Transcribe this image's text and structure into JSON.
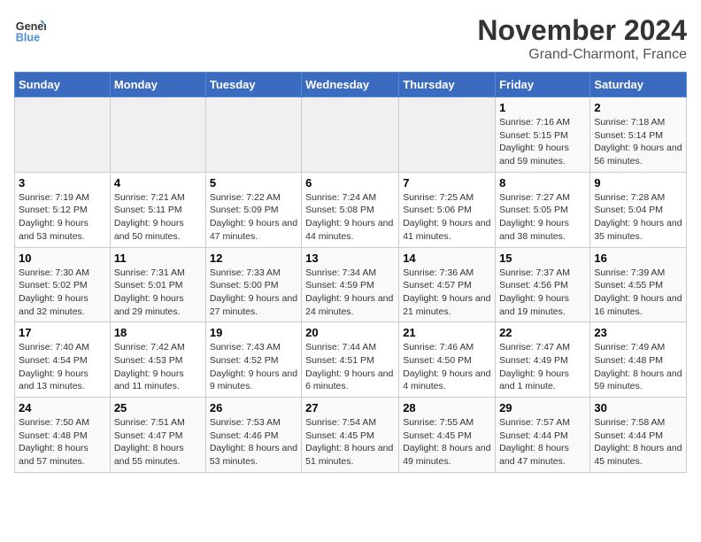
{
  "header": {
    "logo_line1": "General",
    "logo_line2": "Blue",
    "month_title": "November 2024",
    "location": "Grand-Charmont, France"
  },
  "weekdays": [
    "Sunday",
    "Monday",
    "Tuesday",
    "Wednesday",
    "Thursday",
    "Friday",
    "Saturday"
  ],
  "weeks": [
    [
      {
        "day": "",
        "info": ""
      },
      {
        "day": "",
        "info": ""
      },
      {
        "day": "",
        "info": ""
      },
      {
        "day": "",
        "info": ""
      },
      {
        "day": "",
        "info": ""
      },
      {
        "day": "1",
        "info": "Sunrise: 7:16 AM\nSunset: 5:15 PM\nDaylight: 9 hours and 59 minutes."
      },
      {
        "day": "2",
        "info": "Sunrise: 7:18 AM\nSunset: 5:14 PM\nDaylight: 9 hours and 56 minutes."
      }
    ],
    [
      {
        "day": "3",
        "info": "Sunrise: 7:19 AM\nSunset: 5:12 PM\nDaylight: 9 hours and 53 minutes."
      },
      {
        "day": "4",
        "info": "Sunrise: 7:21 AM\nSunset: 5:11 PM\nDaylight: 9 hours and 50 minutes."
      },
      {
        "day": "5",
        "info": "Sunrise: 7:22 AM\nSunset: 5:09 PM\nDaylight: 9 hours and 47 minutes."
      },
      {
        "day": "6",
        "info": "Sunrise: 7:24 AM\nSunset: 5:08 PM\nDaylight: 9 hours and 44 minutes."
      },
      {
        "day": "7",
        "info": "Sunrise: 7:25 AM\nSunset: 5:06 PM\nDaylight: 9 hours and 41 minutes."
      },
      {
        "day": "8",
        "info": "Sunrise: 7:27 AM\nSunset: 5:05 PM\nDaylight: 9 hours and 38 minutes."
      },
      {
        "day": "9",
        "info": "Sunrise: 7:28 AM\nSunset: 5:04 PM\nDaylight: 9 hours and 35 minutes."
      }
    ],
    [
      {
        "day": "10",
        "info": "Sunrise: 7:30 AM\nSunset: 5:02 PM\nDaylight: 9 hours and 32 minutes."
      },
      {
        "day": "11",
        "info": "Sunrise: 7:31 AM\nSunset: 5:01 PM\nDaylight: 9 hours and 29 minutes."
      },
      {
        "day": "12",
        "info": "Sunrise: 7:33 AM\nSunset: 5:00 PM\nDaylight: 9 hours and 27 minutes."
      },
      {
        "day": "13",
        "info": "Sunrise: 7:34 AM\nSunset: 4:59 PM\nDaylight: 9 hours and 24 minutes."
      },
      {
        "day": "14",
        "info": "Sunrise: 7:36 AM\nSunset: 4:57 PM\nDaylight: 9 hours and 21 minutes."
      },
      {
        "day": "15",
        "info": "Sunrise: 7:37 AM\nSunset: 4:56 PM\nDaylight: 9 hours and 19 minutes."
      },
      {
        "day": "16",
        "info": "Sunrise: 7:39 AM\nSunset: 4:55 PM\nDaylight: 9 hours and 16 minutes."
      }
    ],
    [
      {
        "day": "17",
        "info": "Sunrise: 7:40 AM\nSunset: 4:54 PM\nDaylight: 9 hours and 13 minutes."
      },
      {
        "day": "18",
        "info": "Sunrise: 7:42 AM\nSunset: 4:53 PM\nDaylight: 9 hours and 11 minutes."
      },
      {
        "day": "19",
        "info": "Sunrise: 7:43 AM\nSunset: 4:52 PM\nDaylight: 9 hours and 9 minutes."
      },
      {
        "day": "20",
        "info": "Sunrise: 7:44 AM\nSunset: 4:51 PM\nDaylight: 9 hours and 6 minutes."
      },
      {
        "day": "21",
        "info": "Sunrise: 7:46 AM\nSunset: 4:50 PM\nDaylight: 9 hours and 4 minutes."
      },
      {
        "day": "22",
        "info": "Sunrise: 7:47 AM\nSunset: 4:49 PM\nDaylight: 9 hours and 1 minute."
      },
      {
        "day": "23",
        "info": "Sunrise: 7:49 AM\nSunset: 4:48 PM\nDaylight: 8 hours and 59 minutes."
      }
    ],
    [
      {
        "day": "24",
        "info": "Sunrise: 7:50 AM\nSunset: 4:48 PM\nDaylight: 8 hours and 57 minutes."
      },
      {
        "day": "25",
        "info": "Sunrise: 7:51 AM\nSunset: 4:47 PM\nDaylight: 8 hours and 55 minutes."
      },
      {
        "day": "26",
        "info": "Sunrise: 7:53 AM\nSunset: 4:46 PM\nDaylight: 8 hours and 53 minutes."
      },
      {
        "day": "27",
        "info": "Sunrise: 7:54 AM\nSunset: 4:45 PM\nDaylight: 8 hours and 51 minutes."
      },
      {
        "day": "28",
        "info": "Sunrise: 7:55 AM\nSunset: 4:45 PM\nDaylight: 8 hours and 49 minutes."
      },
      {
        "day": "29",
        "info": "Sunrise: 7:57 AM\nSunset: 4:44 PM\nDaylight: 8 hours and 47 minutes."
      },
      {
        "day": "30",
        "info": "Sunrise: 7:58 AM\nSunset: 4:44 PM\nDaylight: 8 hours and 45 minutes."
      }
    ]
  ]
}
